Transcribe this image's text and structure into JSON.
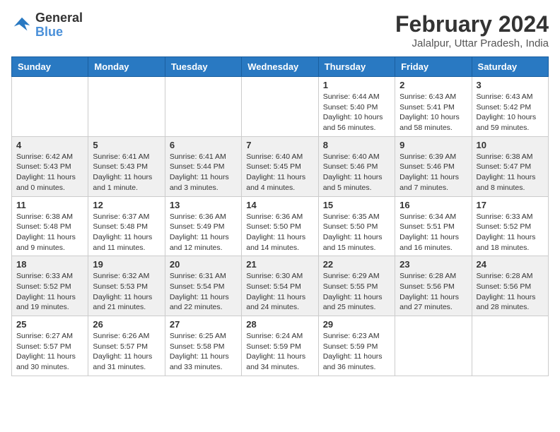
{
  "header": {
    "logo_line1": "General",
    "logo_line2": "Blue",
    "month_year": "February 2024",
    "location": "Jalalpur, Uttar Pradesh, India"
  },
  "weekdays": [
    "Sunday",
    "Monday",
    "Tuesday",
    "Wednesday",
    "Thursday",
    "Friday",
    "Saturday"
  ],
  "weeks": [
    [
      {
        "day": "",
        "sunrise": "",
        "sunset": "",
        "daylight": ""
      },
      {
        "day": "",
        "sunrise": "",
        "sunset": "",
        "daylight": ""
      },
      {
        "day": "",
        "sunrise": "",
        "sunset": "",
        "daylight": ""
      },
      {
        "day": "",
        "sunrise": "",
        "sunset": "",
        "daylight": ""
      },
      {
        "day": "1",
        "sunrise": "Sunrise: 6:44 AM",
        "sunset": "Sunset: 5:40 PM",
        "daylight": "Daylight: 10 hours and 56 minutes."
      },
      {
        "day": "2",
        "sunrise": "Sunrise: 6:43 AM",
        "sunset": "Sunset: 5:41 PM",
        "daylight": "Daylight: 10 hours and 58 minutes."
      },
      {
        "day": "3",
        "sunrise": "Sunrise: 6:43 AM",
        "sunset": "Sunset: 5:42 PM",
        "daylight": "Daylight: 10 hours and 59 minutes."
      }
    ],
    [
      {
        "day": "4",
        "sunrise": "Sunrise: 6:42 AM",
        "sunset": "Sunset: 5:43 PM",
        "daylight": "Daylight: 11 hours and 0 minutes."
      },
      {
        "day": "5",
        "sunrise": "Sunrise: 6:41 AM",
        "sunset": "Sunset: 5:43 PM",
        "daylight": "Daylight: 11 hours and 1 minute."
      },
      {
        "day": "6",
        "sunrise": "Sunrise: 6:41 AM",
        "sunset": "Sunset: 5:44 PM",
        "daylight": "Daylight: 11 hours and 3 minutes."
      },
      {
        "day": "7",
        "sunrise": "Sunrise: 6:40 AM",
        "sunset": "Sunset: 5:45 PM",
        "daylight": "Daylight: 11 hours and 4 minutes."
      },
      {
        "day": "8",
        "sunrise": "Sunrise: 6:40 AM",
        "sunset": "Sunset: 5:46 PM",
        "daylight": "Daylight: 11 hours and 5 minutes."
      },
      {
        "day": "9",
        "sunrise": "Sunrise: 6:39 AM",
        "sunset": "Sunset: 5:46 PM",
        "daylight": "Daylight: 11 hours and 7 minutes."
      },
      {
        "day": "10",
        "sunrise": "Sunrise: 6:38 AM",
        "sunset": "Sunset: 5:47 PM",
        "daylight": "Daylight: 11 hours and 8 minutes."
      }
    ],
    [
      {
        "day": "11",
        "sunrise": "Sunrise: 6:38 AM",
        "sunset": "Sunset: 5:48 PM",
        "daylight": "Daylight: 11 hours and 9 minutes."
      },
      {
        "day": "12",
        "sunrise": "Sunrise: 6:37 AM",
        "sunset": "Sunset: 5:48 PM",
        "daylight": "Daylight: 11 hours and 11 minutes."
      },
      {
        "day": "13",
        "sunrise": "Sunrise: 6:36 AM",
        "sunset": "Sunset: 5:49 PM",
        "daylight": "Daylight: 11 hours and 12 minutes."
      },
      {
        "day": "14",
        "sunrise": "Sunrise: 6:36 AM",
        "sunset": "Sunset: 5:50 PM",
        "daylight": "Daylight: 11 hours and 14 minutes."
      },
      {
        "day": "15",
        "sunrise": "Sunrise: 6:35 AM",
        "sunset": "Sunset: 5:50 PM",
        "daylight": "Daylight: 11 hours and 15 minutes."
      },
      {
        "day": "16",
        "sunrise": "Sunrise: 6:34 AM",
        "sunset": "Sunset: 5:51 PM",
        "daylight": "Daylight: 11 hours and 16 minutes."
      },
      {
        "day": "17",
        "sunrise": "Sunrise: 6:33 AM",
        "sunset": "Sunset: 5:52 PM",
        "daylight": "Daylight: 11 hours and 18 minutes."
      }
    ],
    [
      {
        "day": "18",
        "sunrise": "Sunrise: 6:33 AM",
        "sunset": "Sunset: 5:52 PM",
        "daylight": "Daylight: 11 hours and 19 minutes."
      },
      {
        "day": "19",
        "sunrise": "Sunrise: 6:32 AM",
        "sunset": "Sunset: 5:53 PM",
        "daylight": "Daylight: 11 hours and 21 minutes."
      },
      {
        "day": "20",
        "sunrise": "Sunrise: 6:31 AM",
        "sunset": "Sunset: 5:54 PM",
        "daylight": "Daylight: 11 hours and 22 minutes."
      },
      {
        "day": "21",
        "sunrise": "Sunrise: 6:30 AM",
        "sunset": "Sunset: 5:54 PM",
        "daylight": "Daylight: 11 hours and 24 minutes."
      },
      {
        "day": "22",
        "sunrise": "Sunrise: 6:29 AM",
        "sunset": "Sunset: 5:55 PM",
        "daylight": "Daylight: 11 hours and 25 minutes."
      },
      {
        "day": "23",
        "sunrise": "Sunrise: 6:28 AM",
        "sunset": "Sunset: 5:56 PM",
        "daylight": "Daylight: 11 hours and 27 minutes."
      },
      {
        "day": "24",
        "sunrise": "Sunrise: 6:28 AM",
        "sunset": "Sunset: 5:56 PM",
        "daylight": "Daylight: 11 hours and 28 minutes."
      }
    ],
    [
      {
        "day": "25",
        "sunrise": "Sunrise: 6:27 AM",
        "sunset": "Sunset: 5:57 PM",
        "daylight": "Daylight: 11 hours and 30 minutes."
      },
      {
        "day": "26",
        "sunrise": "Sunrise: 6:26 AM",
        "sunset": "Sunset: 5:57 PM",
        "daylight": "Daylight: 11 hours and 31 minutes."
      },
      {
        "day": "27",
        "sunrise": "Sunrise: 6:25 AM",
        "sunset": "Sunset: 5:58 PM",
        "daylight": "Daylight: 11 hours and 33 minutes."
      },
      {
        "day": "28",
        "sunrise": "Sunrise: 6:24 AM",
        "sunset": "Sunset: 5:59 PM",
        "daylight": "Daylight: 11 hours and 34 minutes."
      },
      {
        "day": "29",
        "sunrise": "Sunrise: 6:23 AM",
        "sunset": "Sunset: 5:59 PM",
        "daylight": "Daylight: 11 hours and 36 minutes."
      },
      {
        "day": "",
        "sunrise": "",
        "sunset": "",
        "daylight": ""
      },
      {
        "day": "",
        "sunrise": "",
        "sunset": "",
        "daylight": ""
      }
    ]
  ]
}
